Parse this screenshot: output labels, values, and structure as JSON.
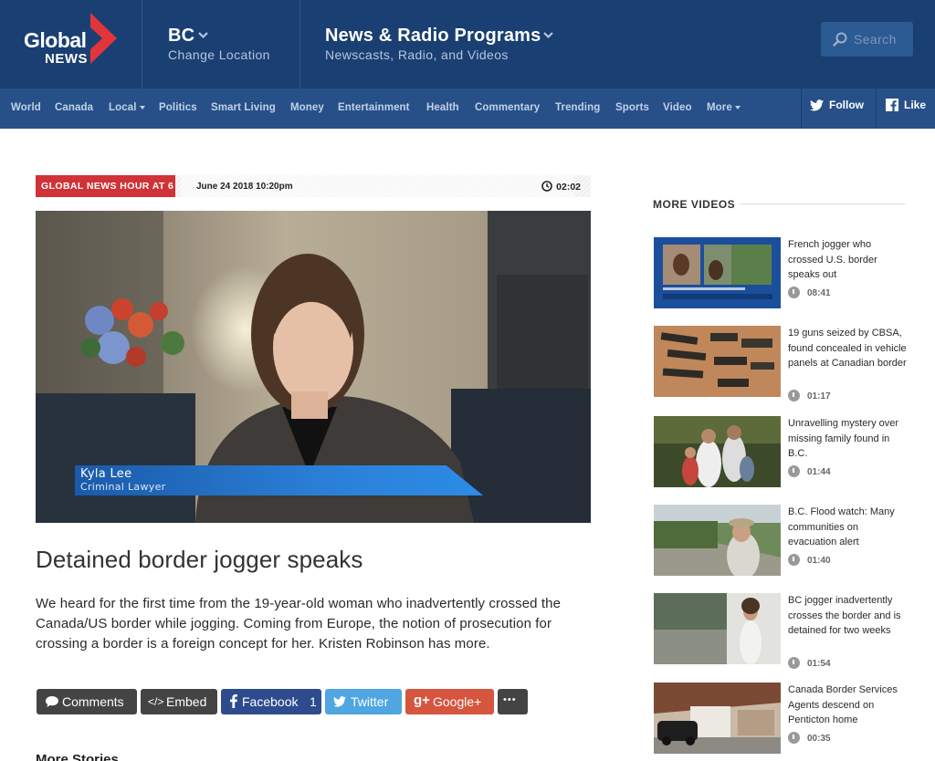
{
  "brand": {
    "logo_text_top": "Global",
    "logo_text_bottom": "NEWS"
  },
  "header": {
    "location_title": "BC",
    "location_sub": "Change Location",
    "programs_title": "News & Radio Programs",
    "programs_sub": "Newscasts, Radio, and Videos",
    "search_placeholder": "Search"
  },
  "nav": {
    "items": [
      "World",
      "Canada",
      "Local",
      "Politics",
      "Smart Living",
      "Money",
      "Entertainment",
      "Health",
      "Commentary",
      "Trending",
      "Sports",
      "Video",
      "More"
    ],
    "follow_label": "Follow",
    "like_label": "Like"
  },
  "video": {
    "show": "GLOBAL NEWS HOUR AT 6",
    "date": "June 24 2018 10:20pm",
    "duration": "02:02",
    "lower_third_name": "Kyla Lee",
    "lower_third_title": "Criminal Lawyer"
  },
  "article": {
    "headline": "Detained border jogger speaks",
    "description": "We heard for the first time from the 19-year-old woman who inadvertently crossed the Canada/US border while jogging. Coming from Europe, the notion of prosecution for crossing a border is a foreign concept for her. Kristen Robinson has more."
  },
  "share": {
    "comments": "Comments",
    "embed_icon": "</>",
    "embed": "Embed",
    "facebook": "Facebook",
    "facebook_count": "1",
    "twitter": "Twitter",
    "google_icon": "g+",
    "google": "Google+",
    "more": "•••"
  },
  "more_stories": "More Stories",
  "sidebar": {
    "title": "MORE VIDEOS",
    "items": [
      {
        "title": "French jogger who crossed U.S. border speaks out",
        "duration": "08:41"
      },
      {
        "title": "19 guns seized by CBSA, found concealed in vehicle panels at Canadian border",
        "duration": "01:17"
      },
      {
        "title": "Unravelling mystery over missing family found in B.C.",
        "duration": "01:44"
      },
      {
        "title": "B.C. Flood watch: Many communities on evacuation alert",
        "duration": "01:40"
      },
      {
        "title": "BC jogger inadvertently crosses the border and is detained for two weeks",
        "duration": "01:54"
      },
      {
        "title": "Canada Border Services Agents descend on Penticton home",
        "duration": "00:35"
      }
    ]
  },
  "colors": {
    "header_bg": "#1a3f72",
    "nav_bg": "#275089",
    "logo_red": "#e2343b",
    "show_badge": "#d03337",
    "comments_btn": "#444444",
    "facebook_btn": "#2e4b8e",
    "twitter_btn": "#4fa6e1",
    "google_btn": "#d6553e"
  },
  "icons": {
    "logo": "global-news-logo",
    "location_chevron": "chevron-down-icon",
    "search": "search-icon",
    "twitter": "twitter-bird-icon",
    "facebook": "facebook-f-icon",
    "clock": "clock-icon",
    "comment": "speech-bubble-icon"
  }
}
